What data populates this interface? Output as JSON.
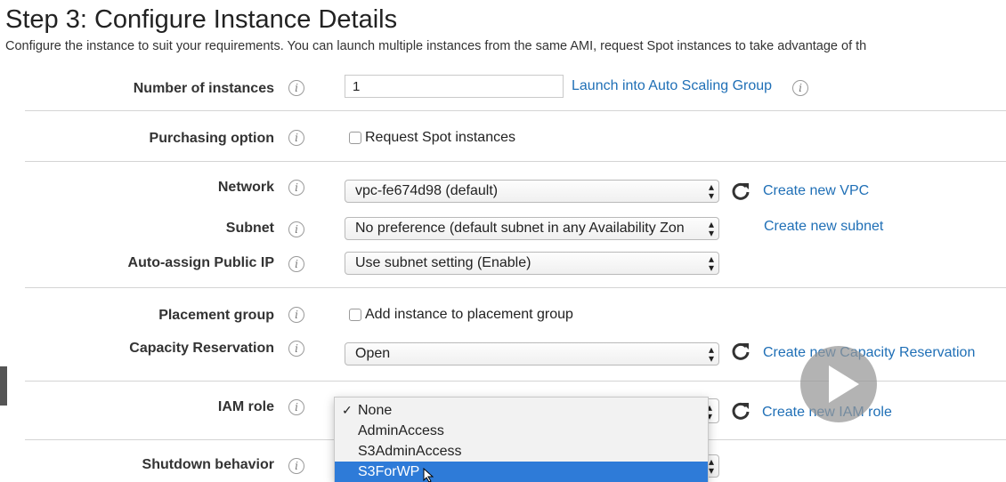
{
  "page": {
    "title": "Step 3: Configure Instance Details",
    "description": "Configure the instance to suit your requirements. You can launch multiple instances from the same AMI, request Spot instances to take advantage of th"
  },
  "fields": {
    "number_of_instances": {
      "label": "Number of instances",
      "value": "1",
      "link": "Launch into Auto Scaling Group"
    },
    "purchasing_option": {
      "label": "Purchasing option",
      "checkbox_label": "Request Spot instances",
      "checked": false
    },
    "network": {
      "label": "Network",
      "value": "vpc-fe674d98 (default)",
      "link": "Create new VPC"
    },
    "subnet": {
      "label": "Subnet",
      "value": "No preference (default subnet in any Availability Zon",
      "link": "Create new subnet"
    },
    "auto_assign_ip": {
      "label": "Auto-assign Public IP",
      "value": "Use subnet setting (Enable)"
    },
    "placement_group": {
      "label": "Placement group",
      "checkbox_label": "Add instance to placement group",
      "checked": false
    },
    "capacity_reservation": {
      "label": "Capacity Reservation",
      "value": "Open",
      "link": "Create new Capacity Reservation"
    },
    "iam_role": {
      "label": "IAM role",
      "link": "Create new IAM role",
      "options": [
        "None",
        "AdminAccess",
        "S3AdminAccess",
        "S3ForWP"
      ],
      "checked_option": "None",
      "highlighted_option": "S3ForWP"
    },
    "shutdown_behavior": {
      "label": "Shutdown behavior"
    }
  },
  "icons": {
    "info": "info-icon",
    "refresh": "refresh-icon",
    "play": "play-icon",
    "select_arrows": "select-arrows-icon"
  },
  "colors": {
    "link": "#1f6fb6",
    "highlight": "#2e7bd8"
  }
}
